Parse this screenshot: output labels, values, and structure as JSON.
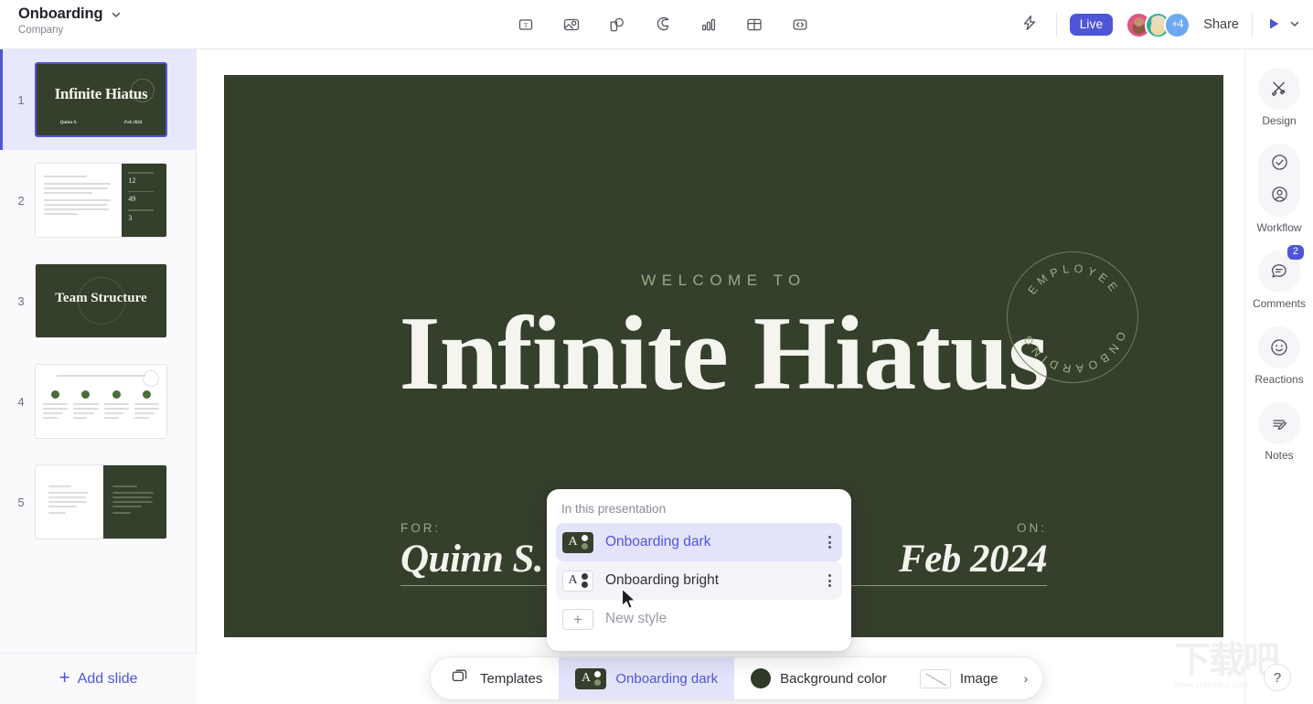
{
  "topbar": {
    "doc_title": "Onboarding",
    "doc_subtitle": "Company",
    "title_chevron": "chevron-down-icon",
    "tools": [
      {
        "name": "text-tool",
        "icon": "text-box-icon"
      },
      {
        "name": "image-tool",
        "icon": "image-icon"
      },
      {
        "name": "shapes-tool",
        "icon": "shapes-icon"
      },
      {
        "name": "sticker-tool",
        "icon": "sticker-icon"
      },
      {
        "name": "chart-tool",
        "icon": "bar-chart-icon"
      },
      {
        "name": "table-tool",
        "icon": "table-icon"
      },
      {
        "name": "embed-tool",
        "icon": "code-embed-icon"
      }
    ],
    "flash_icon": "lightning-icon",
    "live_label": "Live",
    "avatar_more": "+4",
    "share_label": "Share",
    "play_icon": "play-icon",
    "play_chevron": "chevron-down-icon"
  },
  "slides": {
    "add_slide_label": "Add slide",
    "add_slide_plus": "+",
    "items": [
      {
        "number": "1",
        "selected": true,
        "title": "Infinite Hiatus",
        "foot_left": "Quinn S.",
        "foot_right": "Feb 2024"
      },
      {
        "number": "2",
        "selected": false,
        "stats": [
          {
            "value": "12"
          },
          {
            "value": "49"
          },
          {
            "value": "3"
          }
        ]
      },
      {
        "number": "3",
        "selected": false,
        "title": "Team Structure"
      },
      {
        "number": "4",
        "selected": false
      },
      {
        "number": "5",
        "selected": false
      }
    ]
  },
  "slide": {
    "eyebrow": "WELCOME TO",
    "title": "Infinite Hiatus",
    "stamp_top": "EMPLOYEE",
    "stamp_bottom": "ONBOARDING",
    "for_label": "FOR:",
    "for_value": "Quinn S.",
    "on_label": "ON:",
    "on_value": "Feb 2024",
    "background_color": "#343f2c"
  },
  "style_menu": {
    "header": "In this presentation",
    "items": [
      {
        "label": "Onboarding dark",
        "selected": true,
        "theme": "dark",
        "menu_icon": "kebab-menu-icon"
      },
      {
        "label": "Onboarding bright",
        "selected": false,
        "theme": "bright",
        "menu_icon": "kebab-menu-icon"
      }
    ],
    "new_style_label": "New style",
    "new_style_plus": "+"
  },
  "bottombar": {
    "templates_label": "Templates",
    "style_label": "Onboarding dark",
    "background_label": "Background color",
    "background_swatch": "#2f3a28",
    "image_label": "Image",
    "chevron": "›"
  },
  "rail": {
    "design_label": "Design",
    "workflow_label": "Workflow",
    "comments_label": "Comments",
    "comments_badge": "2",
    "reactions_label": "Reactions",
    "notes_label": "Notes"
  },
  "help": {
    "label": "?"
  },
  "watermark": {
    "text": "下载吧",
    "url": "www.xiazaiba.com"
  },
  "colors": {
    "accent": "#4f55d8",
    "slide_bg": "#343f2c",
    "slide_text": "#f4f5ee",
    "eyebrow": "#96ad83"
  }
}
